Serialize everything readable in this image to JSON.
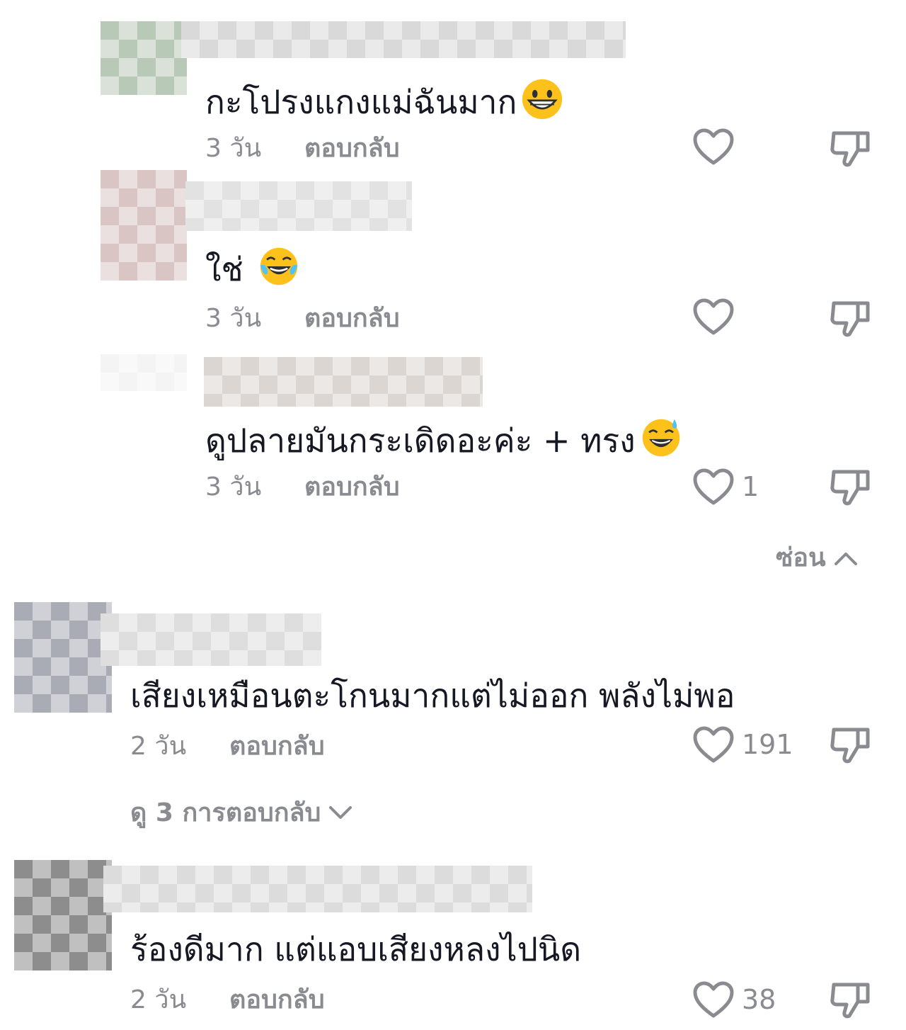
{
  "comments": [
    {
      "text": "กะโปรงแกงแม่ฉันมาก",
      "emoji": "grinning-face-icon",
      "time": "3 วัน",
      "reply_label": "ตอบกลับ",
      "likes": ""
    },
    {
      "text": "ใช่",
      "emoji": "tears-of-joy-icon",
      "time": "3 วัน",
      "reply_label": "ตอบกลับ",
      "likes": ""
    },
    {
      "text": "ดูปลายมันกระเดิดอะค่ะ + ทรง",
      "emoji": "grinning-sweat-icon",
      "time": "3 วัน",
      "reply_label": "ตอบกลับ",
      "likes": "1"
    },
    {
      "text": "เสียงเหมือนตะโกนมากแต่ไม่ออก พลังไม่พอ",
      "time": "2 วัน",
      "reply_label": "ตอบกลับ",
      "likes": "191"
    },
    {
      "text": "ร้องดีมาก แต่แอบเสียงหลงไปนิด",
      "time": "2 วัน",
      "reply_label": "ตอบกลับ",
      "likes": "38"
    }
  ],
  "hide_label": "ซ่อน",
  "view_replies_label": "ดู 3 การตอบกลับ",
  "colors": {
    "text": "#161823",
    "muted": "#8a8b91"
  }
}
